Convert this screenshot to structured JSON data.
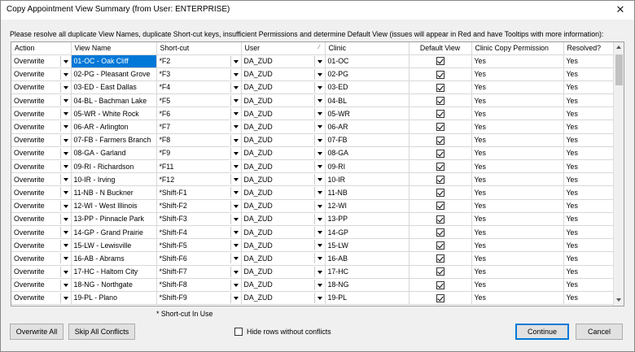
{
  "window": {
    "title": "Copy Appointment View Summary (from User: ENTERPRISE)",
    "close_glyph": "✕"
  },
  "instructions": "Please resolve all duplicate View Names, duplicate Short-cut keys, insufficient Permissions and determine Default View (issues will appear in Red and have Tooltips with more information):",
  "grid": {
    "columns": [
      "Action",
      "View Name",
      "Short-cut",
      "User",
      "Clinic",
      "Default View",
      "Clinic Copy Permission",
      "Resolved?"
    ],
    "sort_indicator": "⁄",
    "rows": [
      {
        "action": "Overwrite",
        "view": "01-OC - Oak Cliff",
        "shortcut": "*F2",
        "user": "DA_ZUD",
        "clinic": "01-OC",
        "default": true,
        "perm": "Yes",
        "resolved": "Yes"
      },
      {
        "action": "Overwrite",
        "view": "02-PG - Pleasant Grove",
        "shortcut": "*F3",
        "user": "DA_ZUD",
        "clinic": "02-PG",
        "default": true,
        "perm": "Yes",
        "resolved": "Yes"
      },
      {
        "action": "Overwrite",
        "view": "03-ED - East Dallas",
        "shortcut": "*F4",
        "user": "DA_ZUD",
        "clinic": "03-ED",
        "default": true,
        "perm": "Yes",
        "resolved": "Yes"
      },
      {
        "action": "Overwrite",
        "view": "04-BL - Bachman Lake",
        "shortcut": "*F5",
        "user": "DA_ZUD",
        "clinic": "04-BL",
        "default": true,
        "perm": "Yes",
        "resolved": "Yes"
      },
      {
        "action": "Overwrite",
        "view": "05-WR - White Rock",
        "shortcut": "*F6",
        "user": "DA_ZUD",
        "clinic": "05-WR",
        "default": true,
        "perm": "Yes",
        "resolved": "Yes"
      },
      {
        "action": "Overwrite",
        "view": "06-AR - Arlington",
        "shortcut": "*F7",
        "user": "DA_ZUD",
        "clinic": "06-AR",
        "default": true,
        "perm": "Yes",
        "resolved": "Yes"
      },
      {
        "action": "Overwrite",
        "view": "07-FB - Farmers Branch",
        "shortcut": "*F8",
        "user": "DA_ZUD",
        "clinic": "07-FB",
        "default": true,
        "perm": "Yes",
        "resolved": "Yes"
      },
      {
        "action": "Overwrite",
        "view": "08-GA - Garland",
        "shortcut": "*F9",
        "user": "DA_ZUD",
        "clinic": "08-GA",
        "default": true,
        "perm": "Yes",
        "resolved": "Yes"
      },
      {
        "action": "Overwrite",
        "view": "09-RI - Richardson",
        "shortcut": "*F11",
        "user": "DA_ZUD",
        "clinic": "09-RI",
        "default": true,
        "perm": "Yes",
        "resolved": "Yes"
      },
      {
        "action": "Overwrite",
        "view": "10-IR - Irving",
        "shortcut": "*F12",
        "user": "DA_ZUD",
        "clinic": "10-IR",
        "default": true,
        "perm": "Yes",
        "resolved": "Yes"
      },
      {
        "action": "Overwrite",
        "view": "11-NB - N Buckner",
        "shortcut": "*Shift-F1",
        "user": "DA_ZUD",
        "clinic": "11-NB",
        "default": true,
        "perm": "Yes",
        "resolved": "Yes"
      },
      {
        "action": "Overwrite",
        "view": "12-WI - West Illinois",
        "shortcut": "*Shift-F2",
        "user": "DA_ZUD",
        "clinic": "12-WI",
        "default": true,
        "perm": "Yes",
        "resolved": "Yes"
      },
      {
        "action": "Overwrite",
        "view": "13-PP - Pinnacle Park",
        "shortcut": "*Shift-F3",
        "user": "DA_ZUD",
        "clinic": "13-PP",
        "default": true,
        "perm": "Yes",
        "resolved": "Yes"
      },
      {
        "action": "Overwrite",
        "view": "14-GP - Grand Prairie",
        "shortcut": "*Shift-F4",
        "user": "DA_ZUD",
        "clinic": "14-GP",
        "default": true,
        "perm": "Yes",
        "resolved": "Yes"
      },
      {
        "action": "Overwrite",
        "view": "15-LW - Lewisville",
        "shortcut": "*Shift-F5",
        "user": "DA_ZUD",
        "clinic": "15-LW",
        "default": true,
        "perm": "Yes",
        "resolved": "Yes"
      },
      {
        "action": "Overwrite",
        "view": "16-AB - Abrams",
        "shortcut": "*Shift-F6",
        "user": "DA_ZUD",
        "clinic": "16-AB",
        "default": true,
        "perm": "Yes",
        "resolved": "Yes"
      },
      {
        "action": "Overwrite",
        "view": "17-HC - Haltom City",
        "shortcut": "*Shift-F7",
        "user": "DA_ZUD",
        "clinic": "17-HC",
        "default": true,
        "perm": "Yes",
        "resolved": "Yes"
      },
      {
        "action": "Overwrite",
        "view": "18-NG - Northgate",
        "shortcut": "*Shift-F8",
        "user": "DA_ZUD",
        "clinic": "18-NG",
        "default": true,
        "perm": "Yes",
        "resolved": "Yes"
      },
      {
        "action": "Overwrite",
        "view": "19-PL - Plano",
        "shortcut": "*Shift-F9",
        "user": "DA_ZUD",
        "clinic": "19-PL",
        "default": true,
        "perm": "Yes",
        "resolved": "Yes"
      }
    ],
    "selected_color": "#0078d7"
  },
  "footnote": "* Short-cut In Use",
  "buttons": {
    "overwrite_all": "Overwrite All",
    "skip_all": "Skip All Conflicts",
    "hide_rows": "Hide rows without conflicts",
    "hide_rows_checked": false,
    "continue": "Continue",
    "cancel": "Cancel"
  }
}
